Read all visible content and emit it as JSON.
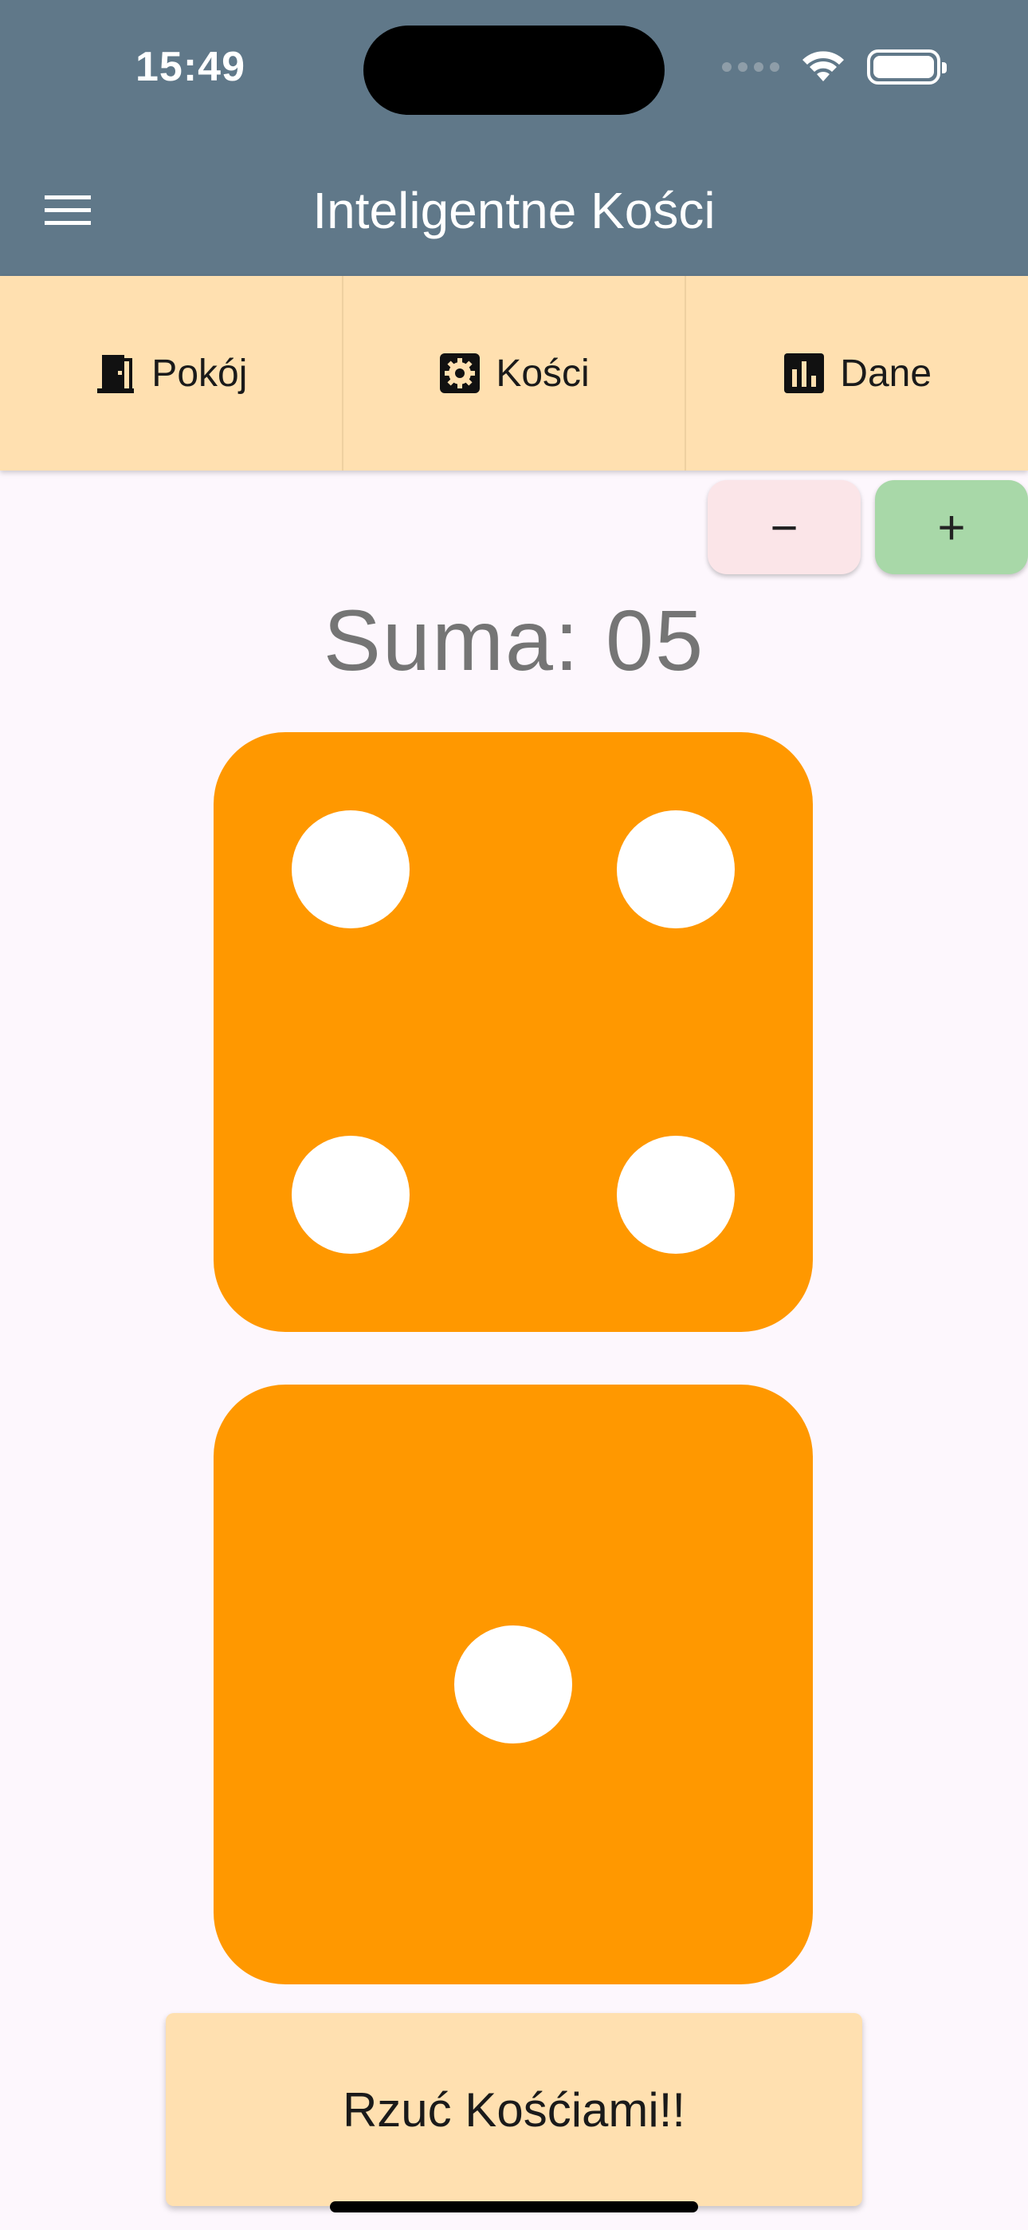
{
  "status_bar": {
    "time": "15:49",
    "icons": [
      "cellular-signal-icon",
      "wifi-icon",
      "battery-icon"
    ]
  },
  "app_bar": {
    "title": "Inteligentne Kości",
    "menu_icon": "hamburger-menu-icon",
    "background_color": "#607889"
  },
  "tabs": [
    {
      "label": "Pokój",
      "icon": "door-icon"
    },
    {
      "label": "Kości",
      "icon": "settings-gear-icon"
    },
    {
      "label": "Dane",
      "icon": "bar-chart-icon"
    }
  ],
  "controls": {
    "minus_label": "−",
    "plus_label": "+"
  },
  "summary": {
    "sum_text": "Suma: 05"
  },
  "dice": [
    {
      "value": 4
    },
    {
      "value": 1
    }
  ],
  "roll_button": {
    "label": "Rzuć Kośćiami!!"
  },
  "colors": {
    "tab_background": "#FFE0B0",
    "die": "#FF9800",
    "minus_button": "#FBE5E8",
    "plus_button": "#A8D8A8",
    "page_background": "#FDF7FD"
  }
}
